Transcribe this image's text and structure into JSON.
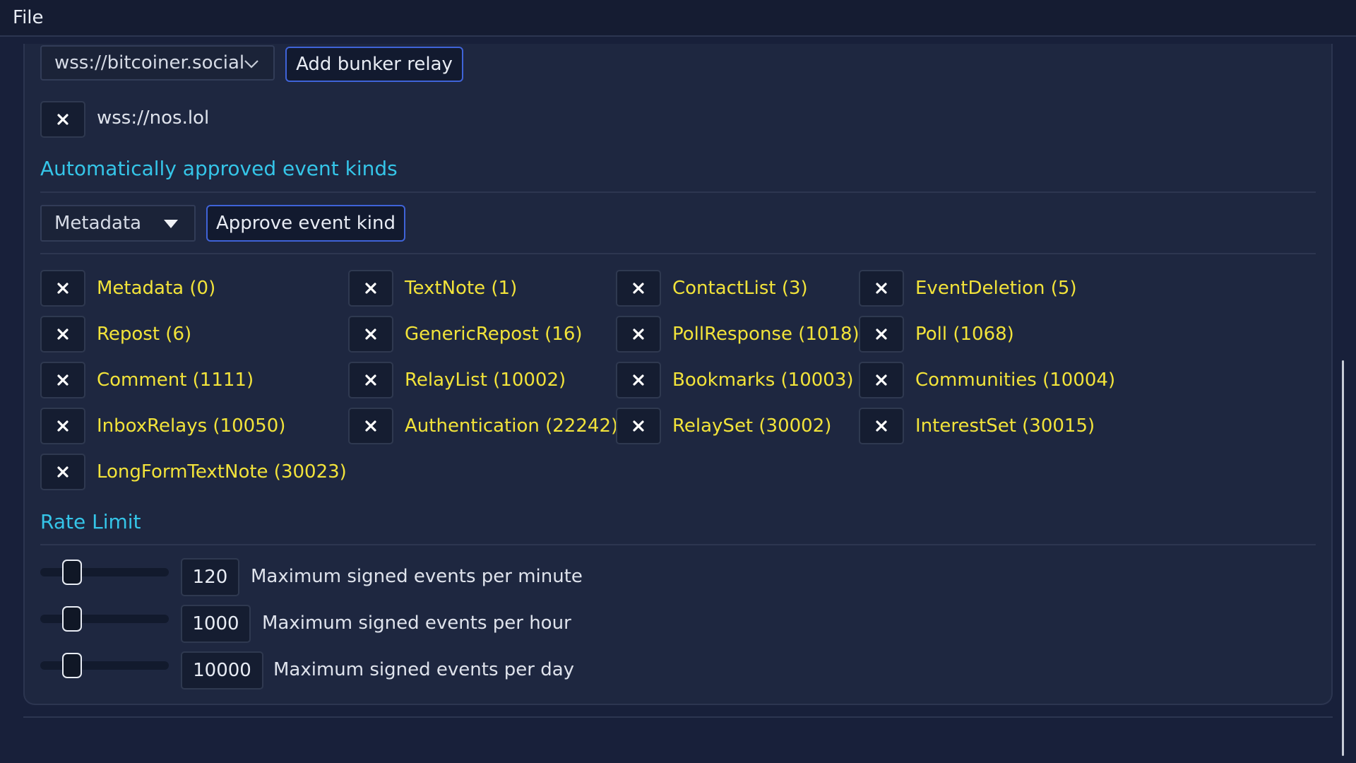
{
  "menu": {
    "file": "File"
  },
  "bunker": {
    "relay_select_value": "wss://bitcoiner.social",
    "add_button_label": "Add bunker relay",
    "relays": [
      "wss://nos.lol"
    ]
  },
  "event_kinds": {
    "heading": "Automatically approved event kinds",
    "select_value": "Metadata",
    "approve_button_label": "Approve event kind",
    "items": [
      "Metadata (0)",
      "TextNote (1)",
      "ContactList (3)",
      "EventDeletion (5)",
      "Repost (6)",
      "GenericRepost (16)",
      "PollResponse (1018)",
      "Poll (1068)",
      "Comment (1111)",
      "RelayList (10002)",
      "Bookmarks (10003)",
      "Communities (10004)",
      "InboxRelays (10050)",
      "Authentication (22242)",
      "RelaySet (30002)",
      "InterestSet (30015)",
      "LongFormTextNote (30023)"
    ]
  },
  "rate_limit": {
    "heading": "Rate Limit",
    "rows": [
      {
        "value": "120",
        "label": "Maximum signed events per minute"
      },
      {
        "value": "1000",
        "label": "Maximum signed events per hour"
      },
      {
        "value": "10000",
        "label": "Maximum signed events per day"
      }
    ]
  },
  "icons": {
    "remove": "close-icon",
    "dropdown_outline": "chevron-down-icon",
    "dropdown_filled": "caret-down-icon"
  },
  "colors": {
    "background": "#18203a",
    "panel": "#1e2740",
    "accent_heading": "#35c5e8",
    "kind_text": "#f2e33a",
    "button_border": "#3f63d8"
  }
}
